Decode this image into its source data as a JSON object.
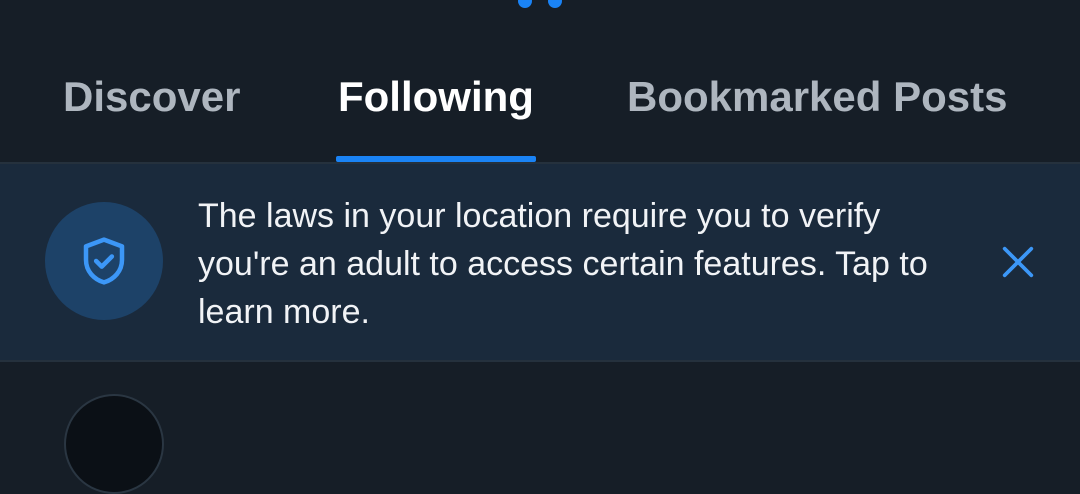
{
  "tabs": [
    {
      "label": "Discover",
      "active": false
    },
    {
      "label": "Following",
      "active": true
    },
    {
      "label": "Bookmarked Posts",
      "active": false
    }
  ],
  "notice": {
    "text": "The laws in your location require you to verify you're an adult to access certain features. Tap to learn more.",
    "icon": "shield-check-icon",
    "close_icon": "close-icon"
  },
  "colors": {
    "background": "#161e27",
    "notice_background": "#1a2a3c",
    "accent": "#1a83f5",
    "tab_inactive": "#aeb6bf",
    "tab_active": "#ffffff"
  }
}
